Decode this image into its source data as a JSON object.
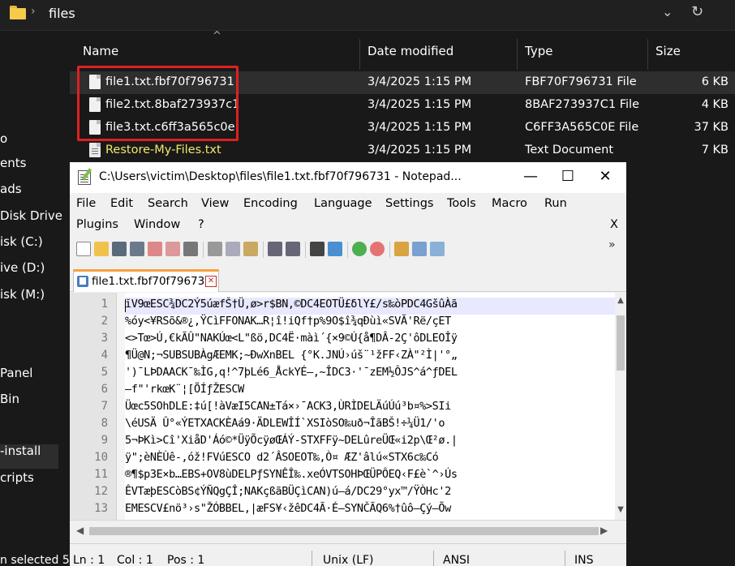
{
  "explorer": {
    "path_folder": "files",
    "columns": {
      "name": "Name",
      "date": "Date modified",
      "type": "Type",
      "size": "Size"
    },
    "files": [
      {
        "name": "file1.txt.fbf70f796731",
        "date": "3/4/2025 1:15 PM",
        "type": "FBF70F796731 File",
        "size": "6 KB"
      },
      {
        "name": "file2.txt.8baf273937c1",
        "date": "3/4/2025 1:15 PM",
        "type": "8BAF273937C1 File",
        "size": "4 KB"
      },
      {
        "name": "file3.txt.c6ff3a565c0e",
        "date": "3/4/2025 1:15 PM",
        "type": "C6FF3A565C0E File",
        "size": "37 KB"
      },
      {
        "name": "Restore-My-Files.txt",
        "date": "3/4/2025 1:15 PM",
        "type": "Text Document",
        "size": "7 KB"
      }
    ],
    "nav_items": [
      "o",
      "ents",
      "ads",
      "Disk Drive",
      "isk (C:)",
      "ive (D:)",
      "isk (M:)",
      "Panel",
      "Bin",
      "-install",
      "cripts"
    ],
    "status": "n selected 5"
  },
  "notepad": {
    "title": "C:\\Users\\victim\\Desktop\\files\\file1.txt.fbf70f796731 - Notepad...",
    "controls": {
      "minimize": "—",
      "maximize": "☐",
      "close": "✕"
    },
    "menu_row1": [
      "File",
      "Edit",
      "Search",
      "View",
      "Encoding",
      "Language",
      "Settings",
      "Tools",
      "Macro",
      "Run"
    ],
    "menu_row2": [
      "Plugins",
      "Window",
      "?"
    ],
    "menu_close": "X",
    "tab_label": "file1.txt.fbf70f796731",
    "tab_close": "✕",
    "toolbar_more": "»",
    "line_numbers": [
      "1",
      "2",
      "3",
      "4",
      "5",
      "6",
      "7",
      "8",
      "9",
      "10",
      "11",
      "12",
      "13"
    ],
    "lines": [
      "ĭV9œESC¾DC2Ý5úæfŠ†Ü,ø>r$BN,©DC4EOTÜ£δlY£/s‰òPDC4GšûÀã",
      "%óy<¥RSõ&®¿,ŸCìFFONAK…R¦î!iQf†p%9O$î¾qÐùì«SVÃ'Rë/çET",
      "<>Tœ>Ú,€kÃÛ\"NAKÚœ<L\"ßö,DC4Ë·màì´{×9©Ú{å¶DÂ-2Ç'ôDLEOÎÿ",
      "¶Ü@N;¬SUBSUBÀgÆEMK;~ÐwXnBEL {°K.JNÚ›úš¨¹žFF‹ZÀ\"²Ì|'°„",
      "')¯LÞDAACK¯‰ÌG,q!^7þLé6_ÅckYÉ—,~ÎDC3·'¯zEM½ÔJS^á^ƒDEL",
      "—f\"'rkœK¨¦[ÕÍƒŽESCW",
      "Üœc5SOhDLE:‡ú[!àVæI5CAN±Tá×›¯ACK3,ÙRÌDELÄúÚú³b¤%>SIi",
      "\\éUSÄ Û°«ÝETXACKÈAá9·ÄDLEWÎÍ`XSIòSO‰uð¬ÎãBŠ!÷¼Ü1/'o",
      "5¬ÞKì>Cî'XiåD'Áó©*ÜÿÕcÿøŒÁÝ-STXFFÿ~DELûreÜŒ«i2p\\Œ²ø.|",
      "ÿ\";èNÈÙê-,óž!FVúESCO  d2´ÂSOEOT‰,Ò¤ ÆZ'âlú«STX6c‰Có",
      "®¶$p3E×b…EBS+OV8ùDELPƒSYNÊÎ‰.xeÓVTSOHÞŒÜPÔEQ‹F£è`^›Ús",
      "ÊVTæþESCòBS¢ÝÑQgÇÎ;NAKçßãBÜÇìCAN)ú–á/DC29°yx™/ŸÒHc'2",
      "EMESCV£nö³›s\"ŽÓBBEL,|æFS¥‹žêDC4Ã·É—SYNČÃQ6%†ûô–Çý–Õw"
    ],
    "status": {
      "line": "Ln : 1",
      "col": "Col : 1",
      "pos": "Pos : 1",
      "eol": "Unix (LF)",
      "encoding": "ANSI",
      "mode": "INS"
    }
  }
}
